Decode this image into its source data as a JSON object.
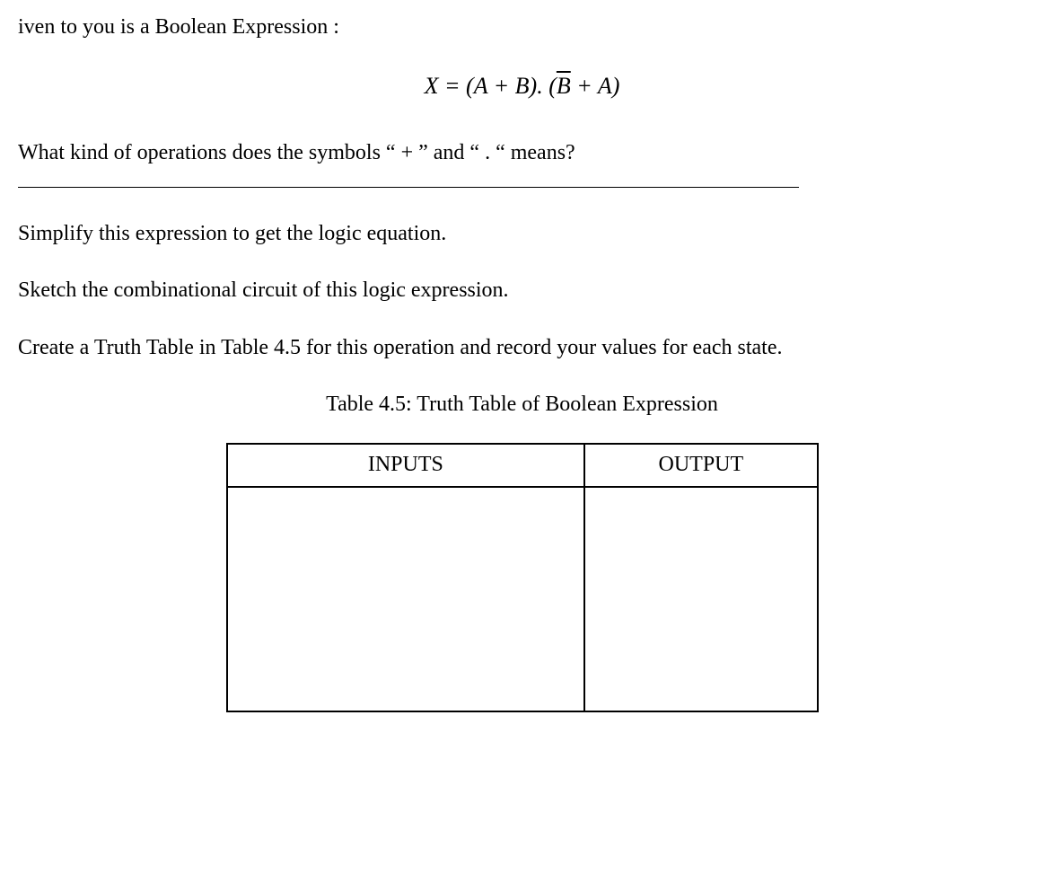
{
  "intro": "iven to you is a Boolean Expression :",
  "equation": {
    "lhs": "X",
    "eq": " = ",
    "part1": "(A + B). (",
    "bar": "B",
    "part2": " + A)"
  },
  "question": "What kind of operations does the symbols “ + ”  and  “ . “ means?",
  "simplify": "Simplify this expression to get the logic equation.",
  "sketch": "Sketch the combinational circuit of this logic expression.",
  "create": "Create a Truth Table in Table 4.5 for this operation and record your values for each state.",
  "table_caption": "Table 4.5: Truth Table of Boolean Expression",
  "table": {
    "header_inputs": "INPUTS",
    "header_output": "OUTPUT"
  }
}
